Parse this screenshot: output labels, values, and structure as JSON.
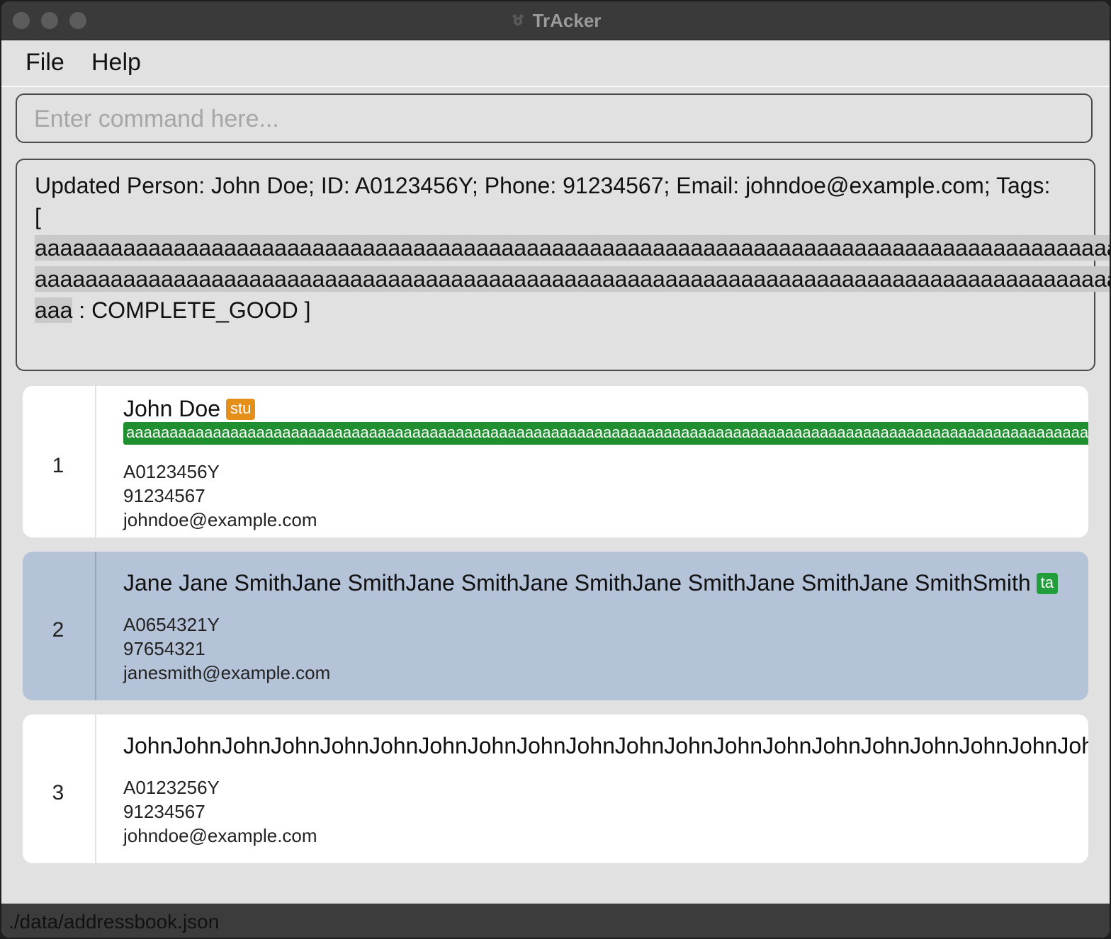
{
  "window": {
    "title": "TrAcker"
  },
  "menu": {
    "file": "File",
    "help": "Help"
  },
  "command": {
    "placeholder": "Enter command here...",
    "value": ""
  },
  "result": {
    "line1": "Updated Person: John Doe; ID: A0123456Y; Phone: 91234567; Email: johndoe@example.com; Tags:",
    "line2": "[",
    "line3": "aaaaaaaaaaaaaaaaaaaaaaaaaaaaaaaaaaaaaaaaaaaaaaaaaaaaaaaaaaaaaaaaaaaaaaaaaaaaaaaaaaaaaa",
    "line4": "aaaaaaaaaaaaaaaaaaaaaaaaaaaaaaaaaaaaaaaaaaaaaaaaaaaaaaaaaaaaaaaaaaaaaaaaaaaaaaaaaaaaaa",
    "line5_highlight": "aaa",
    "line5_rest": " : COMPLETE_GOOD ]"
  },
  "persons": [
    {
      "index": "1",
      "name": "John Doe",
      "tag": "stu",
      "long_tag": "aaaaaaaaaaaaaaaaaaaaaaaaaaaaaaaaaaaaaaaaaaaaaaaaaaaaaaaaaaaaaaaaaaaaaaaaaaaaaaaaaaaaaaaaaaaaaaaaaaaaaaaaaaaaaaaaaaaaaaa",
      "id": "A0123456Y",
      "phone": "91234567",
      "email": "johndoe@example.com"
    },
    {
      "index": "2",
      "name": "Jane Jane SmithJane SmithJane SmithJane SmithJane SmithJane SmithJane SmithSmith",
      "tag": "ta",
      "id": "A0654321Y",
      "phone": "97654321",
      "email": "janesmith@example.com"
    },
    {
      "index": "3",
      "name": "JohnJohnJohnJohnJohnJohnJohnJohnJohnJohnJohnJohnJohnJohnJohnJohnJohnJohnJohnJohnJo",
      "id": "A0123256Y",
      "phone": "91234567",
      "email": "johndoe@example.com"
    }
  ],
  "status": {
    "path": "./data/addressbook.json"
  },
  "colors": {
    "tag_stu": "#e5901b",
    "tag_ta": "#229f3c",
    "long_tag": "#1f8f2f",
    "selected_card": "#b5c3d8"
  }
}
